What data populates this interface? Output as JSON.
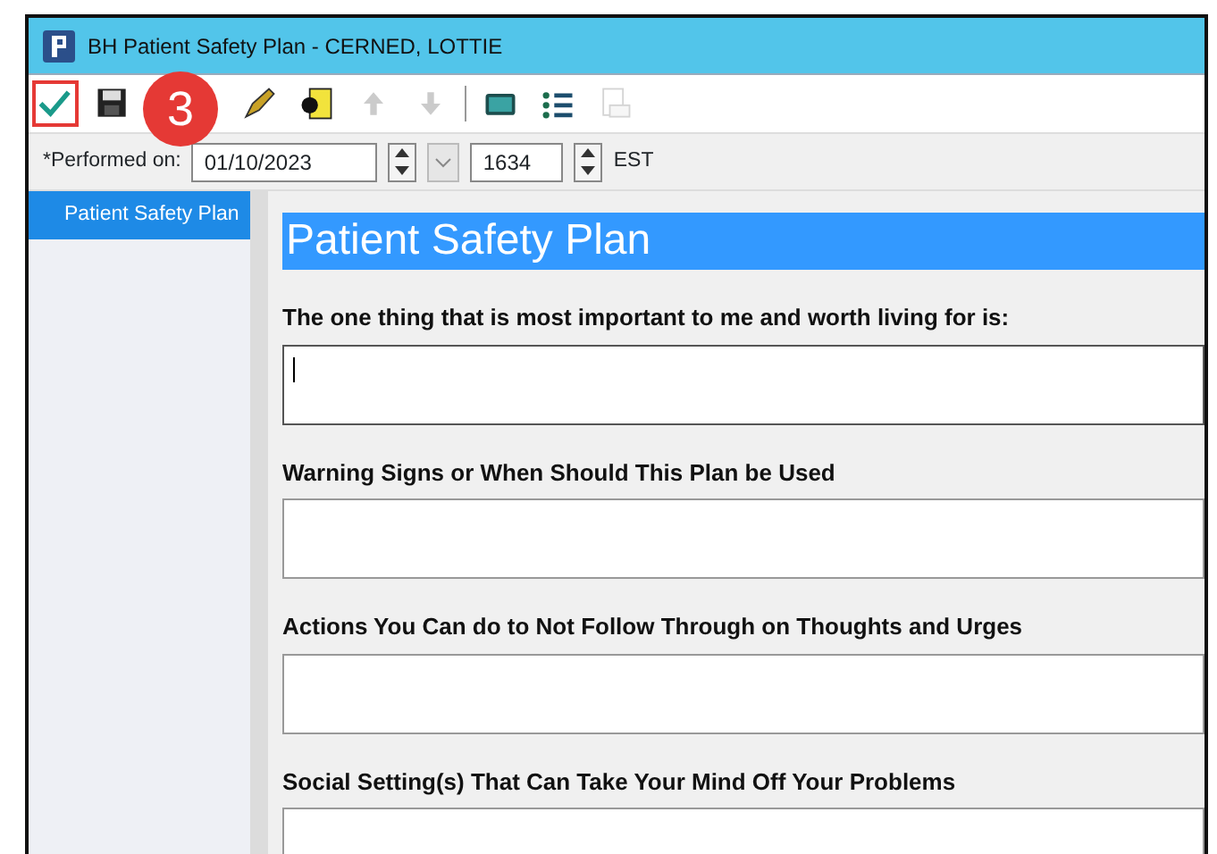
{
  "window": {
    "title": "BH Patient Safety Plan - CERNED, LOTTIE"
  },
  "toolbar": [
    {
      "kind": "check",
      "highlighted": true,
      "disabled": false
    },
    {
      "kind": "save",
      "highlighted": false,
      "disabled": false
    },
    {
      "kind": "pen",
      "highlighted": false,
      "disabled": false
    },
    {
      "kind": "document",
      "highlighted": false,
      "disabled": false
    },
    {
      "kind": "up",
      "highlighted": false,
      "disabled": true
    },
    {
      "kind": "down",
      "highlighted": false,
      "disabled": true
    },
    {
      "kind": "separator"
    },
    {
      "kind": "calculator",
      "highlighted": false,
      "disabled": false
    },
    {
      "kind": "checklist",
      "highlighted": false,
      "disabled": false
    },
    {
      "kind": "print",
      "highlighted": false,
      "disabled": true
    }
  ],
  "callout": {
    "label": "3"
  },
  "performed": {
    "label": "*Performed on:",
    "date": "01/10/2023",
    "time": "1634",
    "zone": "EST"
  },
  "sidebar": {
    "items": [
      {
        "label": "Patient Safety Plan",
        "selected": true
      }
    ]
  },
  "form": {
    "heading": "Patient Safety Plan",
    "questions": [
      {
        "label": "The one thing that is most important to me and worth living for is:",
        "focused": true
      },
      {
        "label": "Warning Signs or When Should This Plan be Used",
        "focused": false
      },
      {
        "label": "Actions You Can do to Not Follow Through on Thoughts and Urges",
        "focused": false
      },
      {
        "label": "Social Setting(s) That Can Take Your Mind Off Your Problems",
        "focused": false
      }
    ]
  }
}
